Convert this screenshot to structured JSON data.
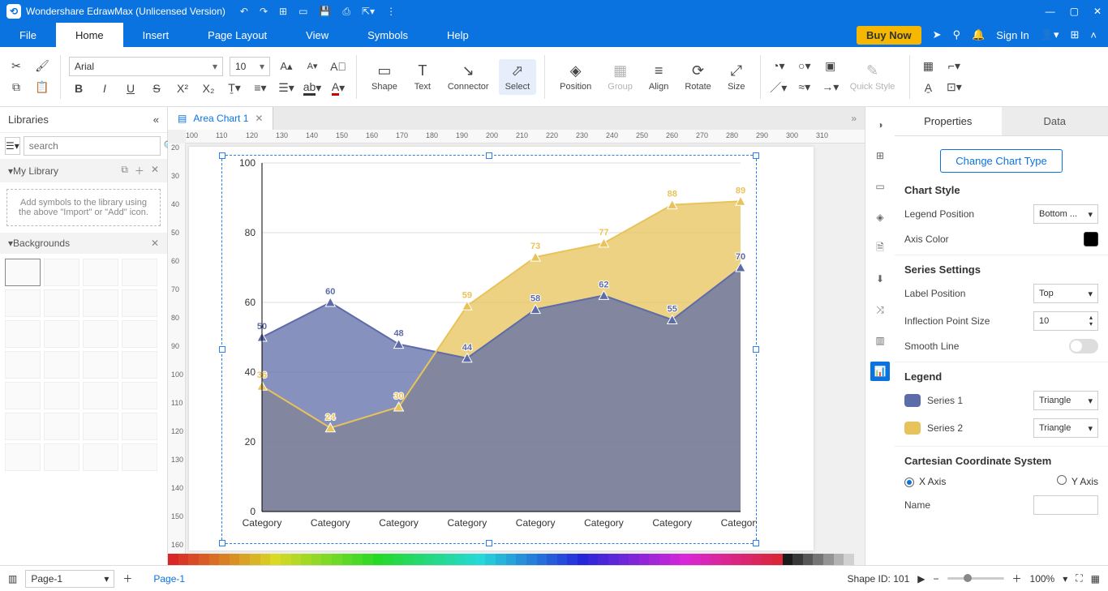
{
  "titlebar": {
    "title": "Wondershare EdrawMax (Unlicensed Version)"
  },
  "menubar": {
    "tabs": [
      "File",
      "Home",
      "Insert",
      "Page Layout",
      "View",
      "Symbols",
      "Help"
    ],
    "active": 1,
    "buy": "Buy Now",
    "signin": "Sign In"
  },
  "ribbon": {
    "font": "Arial",
    "size": "10",
    "groups": {
      "shape": "Shape",
      "text": "Text",
      "connector": "Connector",
      "select": "Select",
      "position": "Position",
      "group": "Group",
      "align": "Align",
      "rotate": "Rotate",
      "size": "Size",
      "quick": "Quick Style"
    }
  },
  "left": {
    "title": "Libraries",
    "search_ph": "search",
    "mylib": "My Library",
    "hint": "Add symbols to the library using the above \"Import\" or \"Add\" icon.",
    "backgrounds": "Backgrounds"
  },
  "tab": {
    "name": "Area Chart 1"
  },
  "props": {
    "tabs": [
      "Properties",
      "Data"
    ],
    "change": "Change Chart Type",
    "style": "Chart Style",
    "legendpos_label": "Legend Position",
    "legendpos": "Bottom ...",
    "axiscolor": "Axis Color",
    "series": "Series Settings",
    "labelpos_label": "Label Position",
    "labelpos": "Top",
    "infl_label": "Inflection Point Size",
    "infl": "10",
    "smooth": "Smooth Line",
    "legend": "Legend",
    "s1": "Series 1",
    "s1shape": "Triangle",
    "s2": "Series 2",
    "s2shape": "Triangle",
    "cart": "Cartesian Coordinate System",
    "xaxis": "X Axis",
    "yaxis": "Y Axis",
    "name_label": "Name"
  },
  "status": {
    "page": "Page-1",
    "pagelink": "Page-1",
    "shapeid": "Shape ID: 101",
    "zoom": "100%"
  },
  "chart_data": {
    "type": "area",
    "categories": [
      "Category",
      "Category",
      "Category",
      "Category",
      "Category",
      "Category",
      "Category",
      "Category"
    ],
    "series": [
      {
        "name": "Series 1",
        "color": "#5d6ca8",
        "values": [
          50,
          60,
          48,
          44,
          58,
          62,
          55,
          70
        ]
      },
      {
        "name": "Series 2",
        "color": "#e8c35b",
        "values": [
          36,
          24,
          30,
          59,
          73,
          77,
          88,
          89
        ]
      }
    ],
    "ylim": [
      0,
      100
    ],
    "legend_position": "bottom",
    "label_position": "top"
  },
  "ruler_h": [
    100,
    110,
    120,
    130,
    140,
    150,
    160,
    170,
    180,
    190,
    200,
    210,
    220,
    230,
    240,
    250,
    260,
    270,
    280,
    290,
    300,
    310
  ],
  "ruler_v": [
    20,
    30,
    40,
    50,
    60,
    70,
    80,
    90,
    100,
    110,
    120,
    130,
    140,
    150,
    160
  ]
}
